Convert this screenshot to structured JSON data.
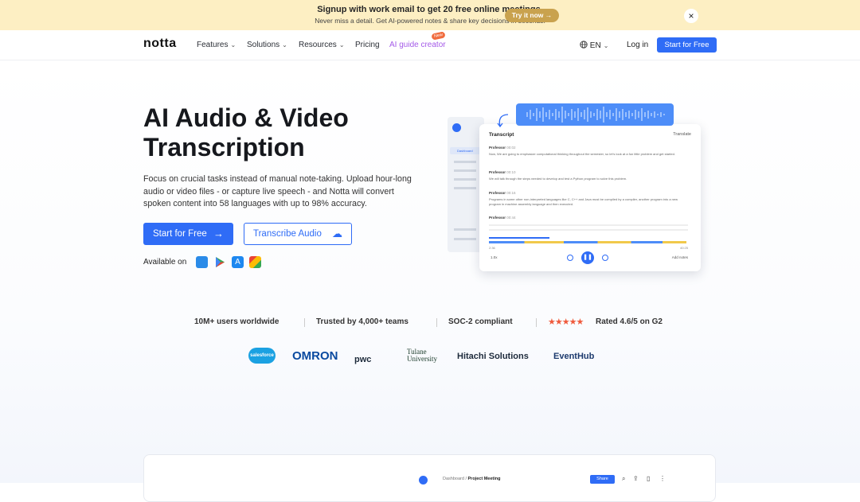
{
  "promo": {
    "title": "Signup with work email to get 20 free online meetings.",
    "subtitle": "Never miss a detail. Get AI-powered notes & share key decisions in seconds.",
    "cta": "Try it now →",
    "close": "×"
  },
  "nav": {
    "logo": "notta",
    "features": "Features",
    "solutions": "Solutions",
    "resources": "Resources",
    "pricing": "Pricing",
    "ai_guide": "AI guide creator",
    "new_badge": "New",
    "lang": "EN",
    "login": "Log in",
    "start": "Start for Free"
  },
  "hero": {
    "title_line1": "AI Audio & Video",
    "title_line2": "Transcription",
    "description": "Focus on crucial tasks instead of manual note-taking. Upload hour-long audio or video files - or capture live speech - and Notta will convert spoken content into 58 languages with up to 98% accuracy.",
    "start_button": "Start for Free",
    "transcribe_button": "Transcribe Audio",
    "available_on": "Available on"
  },
  "mock": {
    "transcript_header": "Transcript",
    "translate": "Translate",
    "speakers": [
      "Professor",
      "Professor",
      "Professor",
      "Professor"
    ],
    "times": [
      "00:02",
      "00:10",
      "00:16",
      "00:44"
    ],
    "lines": [
      "Now, We are going to emphasize computational thinking throughout the semester, so let's look at a fun little problem and get started.",
      "We will talk through the steps needed to develop and test a Python program to solve this problem.",
      "Programs in some other non-interpreted languages like C, C++ and Java must be compiled by a compiler, another program into a new program in machine assembly language and then executed.",
      ""
    ],
    "sidebar_item": "Dashboard",
    "start_time": "2:36",
    "end_time": "40:25",
    "speed": "1.0x",
    "add_notes": "Add notes"
  },
  "stats": {
    "users": "10M+ users worldwide",
    "teams": "Trusted by 4,000+ teams",
    "soc": "SOC-2 compliant",
    "rating": "Rated 4.6/5 on G2",
    "stars": "★★★★★"
  },
  "logos": {
    "salesforce": "salesforce",
    "omron": "OMRON",
    "pwc": "pwc",
    "tulane": "Tulane University",
    "hitachi": "Hitachi Solutions",
    "eventhub": "EventHub"
  },
  "bottom": {
    "breadcrumb_root": "Dashboard",
    "breadcrumb_sep": "/",
    "breadcrumb_page": "Project Meeting",
    "share": "Share"
  },
  "colors": {
    "accent": "#2f6cf6",
    "promo_bg": "#fdefc3",
    "ai_guide": "#a45ae8"
  }
}
